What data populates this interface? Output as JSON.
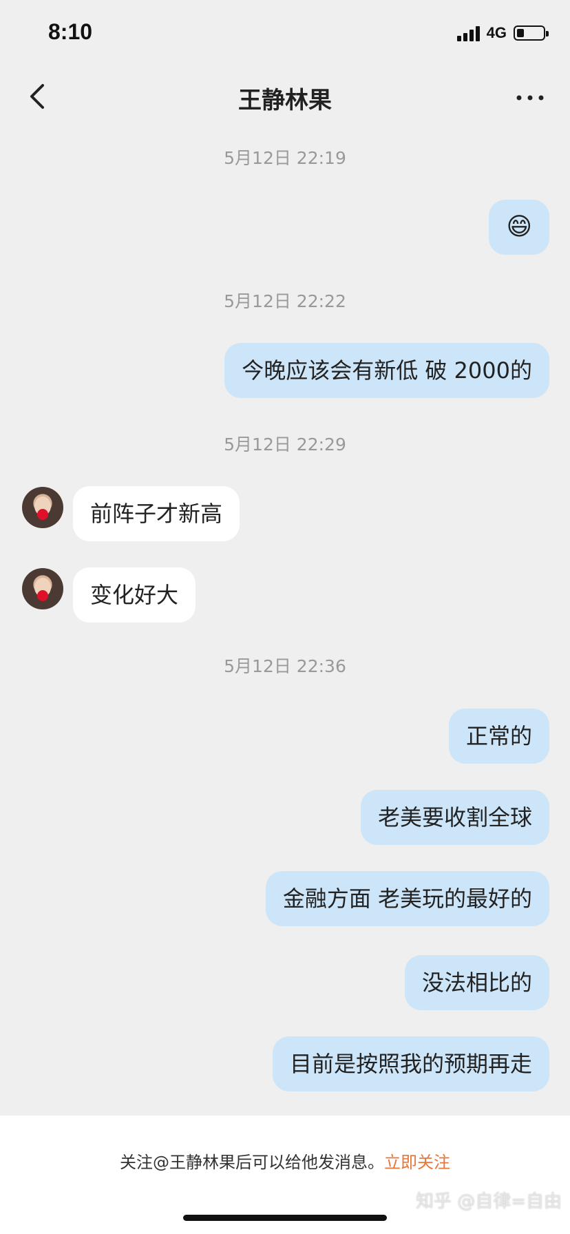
{
  "status_bar": {
    "time": "8:10",
    "network": "4G"
  },
  "header": {
    "title": "王静林果"
  },
  "messages": [
    {
      "type": "timestamp",
      "text": "5月12日 22:19"
    },
    {
      "type": "out",
      "text": "😄"
    },
    {
      "type": "timestamp",
      "text": "5月12日 22:22"
    },
    {
      "type": "out",
      "text": "今晚应该会有新低 破 2000的"
    },
    {
      "type": "timestamp",
      "text": "5月12日 22:29"
    },
    {
      "type": "in",
      "text": "前阵子才新高"
    },
    {
      "type": "in",
      "text": "变化好大"
    },
    {
      "type": "timestamp",
      "text": "5月12日 22:36"
    },
    {
      "type": "out",
      "text": "正常的"
    },
    {
      "type": "out",
      "text": "老美要收割全球"
    },
    {
      "type": "out",
      "text": "金融方面 老美玩的最好的"
    },
    {
      "type": "out",
      "text": "没法相比的"
    },
    {
      "type": "out",
      "text": "目前是按照我的预期再走"
    }
  ],
  "footer": {
    "notice": "关注@王静林果后可以给他发消息。",
    "follow_link": "立即关注",
    "watermark": "知乎 @自律=自由"
  },
  "colors": {
    "outgoing_bubble": "#cde5f8",
    "incoming_bubble": "#ffffff",
    "background": "#efefef",
    "link": "#e8753a"
  }
}
